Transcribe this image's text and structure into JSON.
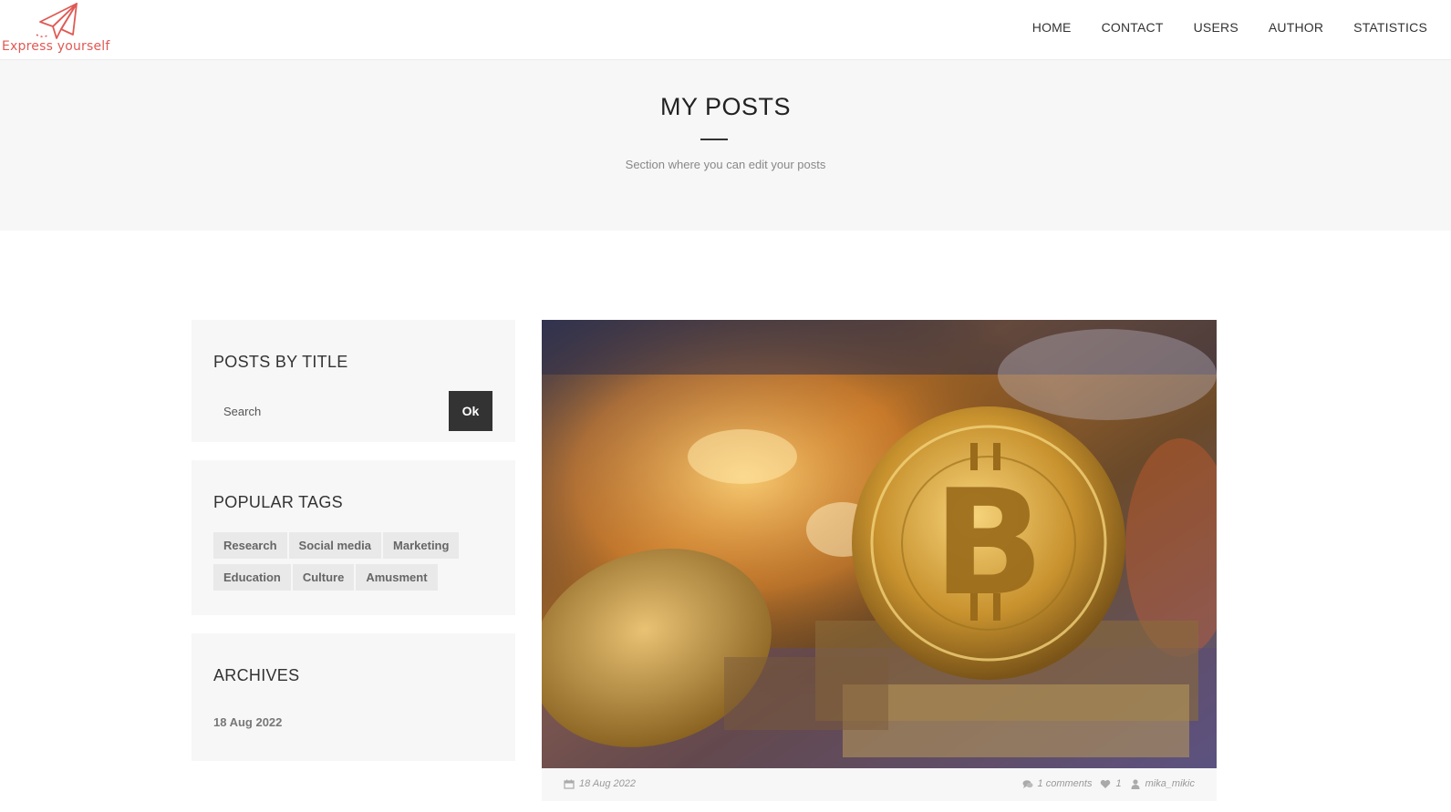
{
  "header": {
    "logo_text": "Express yourself",
    "nav": [
      {
        "label": "HOME"
      },
      {
        "label": "CONTACT"
      },
      {
        "label": "USERS"
      },
      {
        "label": "AUTHOR"
      },
      {
        "label": "STATISTICS"
      }
    ]
  },
  "hero": {
    "title": "MY POSTS",
    "subtitle": "Section where you can edit your posts"
  },
  "sidebar": {
    "search": {
      "title": "POSTS BY TITLE",
      "placeholder": "Search",
      "button_label": "Ok"
    },
    "tags": {
      "title": "POPULAR TAGS",
      "items": [
        "Research",
        "Social media",
        "Marketing",
        "Education",
        "Culture",
        "Amusment"
      ]
    },
    "archives": {
      "title": "ARCHIVES",
      "items": [
        "18 Aug 2022"
      ]
    }
  },
  "post": {
    "image_icon": "bitcoin-coin-photo",
    "date": "18 Aug 2022",
    "comments": "1 comments",
    "likes": "1",
    "author": "mika_mikic"
  },
  "colors": {
    "brand": "#e05a55",
    "button_dark": "#333333",
    "panel_bg": "#f7f7f7",
    "tag_bg": "#e9e9e9"
  }
}
